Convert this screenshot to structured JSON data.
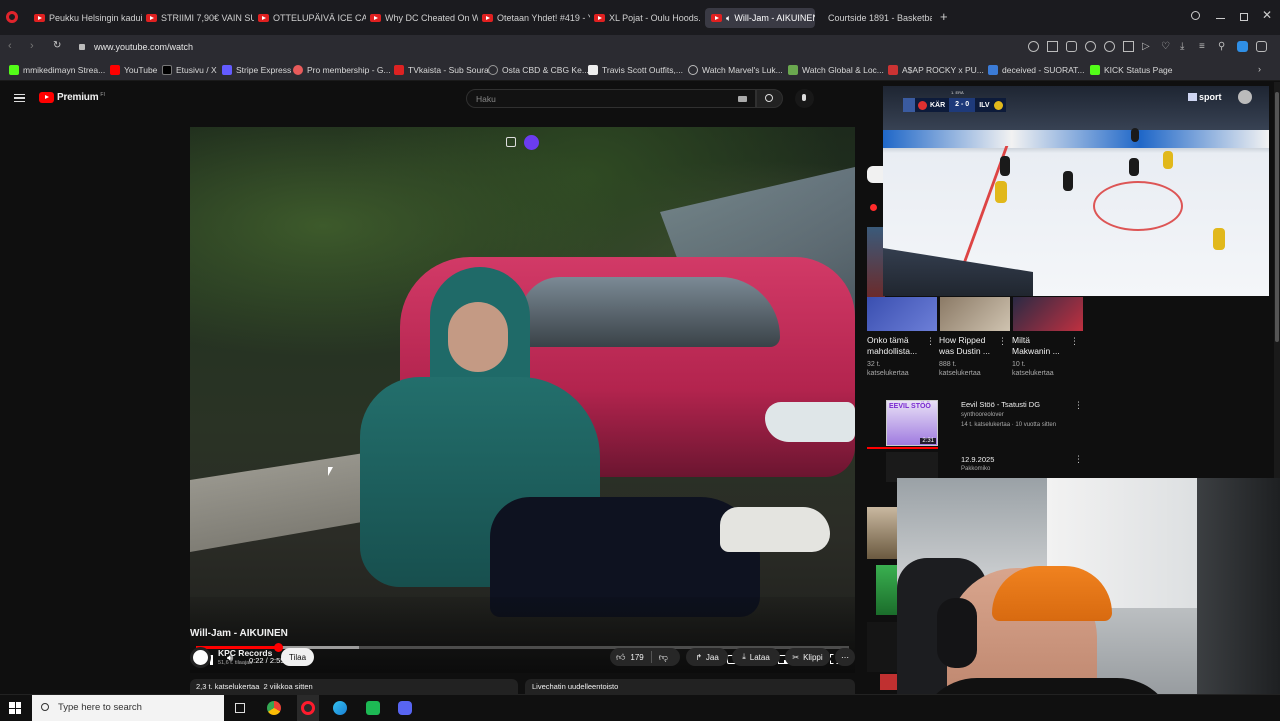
{
  "browser": {
    "tabs": [
      {
        "label": "Peukku Helsingin kaduilla"
      },
      {
        "label": "STRIIMI 7,90€ VAIN SUNN"
      },
      {
        "label": "OTTELUPÄIVÄ ICE CAGE 5"
      },
      {
        "label": "Why DC Cheated On Wei"
      },
      {
        "label": "Otetaan Yhdet! #419 - You"
      },
      {
        "label": "XL Pojat - Oulu Hoods. N"
      },
      {
        "label": "Will-Jam - AIKUINEN"
      },
      {
        "label": "Courtside 1891 - Basketba"
      }
    ],
    "url": "www.youtube.com/watch",
    "bookmarks": [
      {
        "label": "mmikedimayn Strea..."
      },
      {
        "label": "YouTube"
      },
      {
        "label": "Etusivu / X"
      },
      {
        "label": "Stripe Express"
      },
      {
        "label": "Pro membership - G..."
      },
      {
        "label": "TVkaista - Sub Soura"
      },
      {
        "label": "Osta CBD & CBG Ke..."
      },
      {
        "label": "Travis Scott Outfits,..."
      },
      {
        "label": "Watch Marvel's Luk..."
      },
      {
        "label": "Watch Global & Loc..."
      },
      {
        "label": "A$AP ROCKY x PU..."
      },
      {
        "label": "deceived - SUORAT..."
      },
      {
        "label": "KICK Status Page"
      }
    ]
  },
  "youtube": {
    "logo": "Premium",
    "logo_sup": "FI",
    "search_placeholder": "Haku",
    "video": {
      "time": "0:22 / 2:55",
      "progress": 0.126,
      "buffered": 0.25,
      "title": "Will-Jam - AIKUINEN",
      "channel": "KPC Records",
      "subs": "51,6 t. tilaajaa",
      "subscribe": "Tilaa",
      "likes": "179",
      "share": "Jaa",
      "download": "Lataa",
      "clip": "Klippi",
      "views_date": "2,3 t. katselukertaa  2 viikkoa sitten",
      "livechat": "Livechatin uudelleentoisto"
    },
    "recs_row": [
      {
        "title1": "Onko tämä",
        "title2": "mahdollista...",
        "meta1": "32 t.",
        "meta2": "katselukertaa"
      },
      {
        "title1": "How Ripped",
        "title2": "was Dustin ...",
        "meta1": "888 t.",
        "meta2": "katselukertaa"
      },
      {
        "title1": "Miltä",
        "title2": "Makwanin ...",
        "meta1": "10 t.",
        "meta2": "katselukertaa"
      }
    ],
    "recs_list": [
      {
        "thumb_text": "EEVIL STÖÖ",
        "duration": "2:31",
        "title": "Eevil Stöö - Tsatusti DG",
        "channel": "synthooreolover",
        "meta": "14 t. katselukertaa · 10 vuotta sitten"
      },
      {
        "thumb_text": "",
        "duration": "",
        "title": "12.9.2025",
        "channel": "Pakkomiko",
        "meta": ""
      }
    ]
  },
  "overlay_hockey": {
    "brand": "sport",
    "team_home": "KÄR",
    "score": "2 - 0",
    "team_away": "ILV",
    "period": "1. ERÄ"
  },
  "taskbar": {
    "search_placeholder": "Type here to search"
  },
  "colors": {
    "yt_red": "#ff0000",
    "progress_red": "#f00",
    "accent_purple": "#6b3cf0"
  }
}
